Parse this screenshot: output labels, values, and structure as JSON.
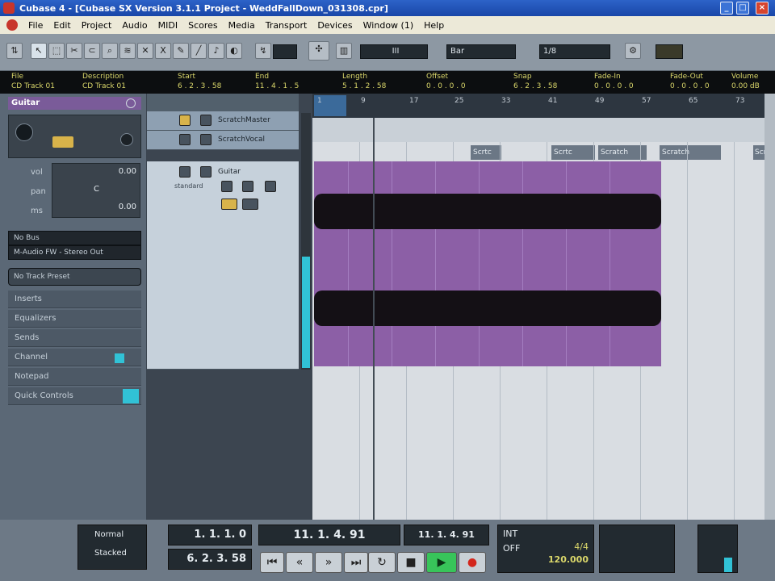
{
  "window": {
    "title": "Cubase 4 - [Cubase SX Version 3.1.1 Project - WeddFallDown_031308.cpr]",
    "min": "_",
    "max": "□",
    "close": "×"
  },
  "menu": [
    "File",
    "Edit",
    "Project",
    "Audio",
    "MIDI",
    "Scores",
    "Media",
    "Transport",
    "Devices",
    "Window (1)",
    "Help"
  ],
  "toolbar": {
    "quantize": "III",
    "snap_type": "Bar",
    "quant_value": "1/8"
  },
  "infoline": {
    "headers": [
      "File",
      "Description",
      "Start",
      "End",
      "Length",
      "Offset",
      "Snap",
      "Fade-In",
      "Fade-Out",
      "Volume"
    ],
    "values": [
      "CD Track 01",
      "CD Track 01",
      "6 . 2 . 3 . 58",
      "11 . 4 . 1 . 5",
      "5 . 1 . 2 . 58",
      "0 . 0 . 0 . 0",
      "6 . 2 . 3 . 58",
      "0 . 0 . 0 . 0",
      "0 . 0 . 0 . 0",
      "0.00 dB"
    ]
  },
  "inspector": {
    "track_name": "Guitar",
    "vol_label": "vol",
    "pan_label": "pan",
    "delay_label": "ms",
    "vol_value": "0.00",
    "pan_value": "C",
    "delay_value": "0.00",
    "input_routing": "No Bus",
    "output_routing": "M-Audio FW - Stereo Out",
    "preset": "No Track Preset",
    "sections": [
      "Inserts",
      "Equalizers",
      "Sends",
      "Channel",
      "Notepad",
      "Quick Controls"
    ]
  },
  "tracks": [
    {
      "name": "ScratchMaster"
    },
    {
      "name": "ScratchVocal"
    },
    {
      "name": "Guitar",
      "sub": "standard"
    }
  ],
  "ruler": [
    "1",
    "9",
    "17",
    "25",
    "33",
    "41",
    "49",
    "57",
    "65",
    "73"
  ],
  "markers": [
    "Scrtc",
    "Scrtc",
    "Scratch",
    "Scratch",
    "Scratch"
  ],
  "transport": {
    "mode": "Normal",
    "cycle": "Stacked",
    "left_locator": "1. 1. 1. 0",
    "right_locator": "6. 2. 3. 58",
    "position": "11. 1. 4. 91",
    "secondary": "11. 1. 4. 91",
    "tempo": "120.000",
    "signature": "4/4",
    "sync": "INT",
    "off": "OFF"
  }
}
